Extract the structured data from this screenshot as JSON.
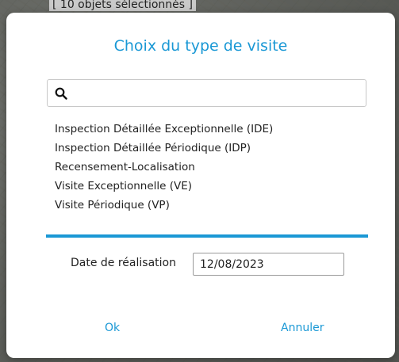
{
  "background": {
    "selection_text": "[ 10 objets sélectionnés ]"
  },
  "dialog": {
    "title": "Choix du type de visite",
    "search": {
      "icon": "search-icon",
      "value": "",
      "placeholder": ""
    },
    "visit_types": [
      "Inspection Détaillée Exceptionnelle (IDE)",
      "Inspection Détaillée Périodique (IDP)",
      "Recensement-Localisation",
      "Visite Exceptionnelle (VE)",
      "Visite Périodique (VP)"
    ],
    "date_label": "Date de réalisation",
    "date_value": "12/08/2023",
    "ok_label": "Ok",
    "cancel_label": "Annuler"
  },
  "colors": {
    "accent": "#1a98d5",
    "text": "#222222"
  }
}
